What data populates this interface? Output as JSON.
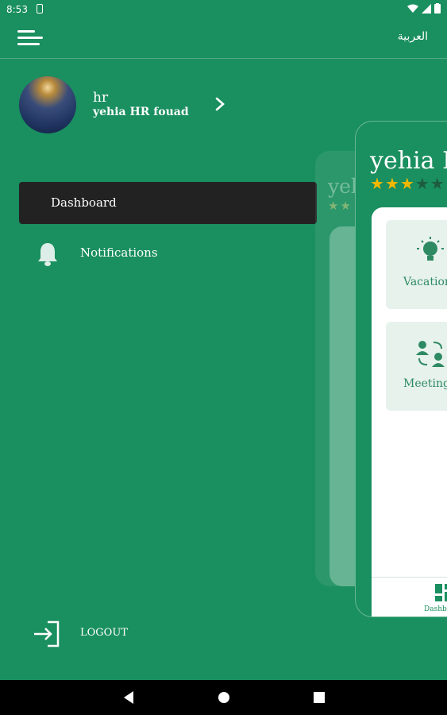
{
  "status_bar": {
    "time": "8:53"
  },
  "topbar": {
    "language_label": "العربية"
  },
  "profile": {
    "role": "hr",
    "name": "yehia HR fouad"
  },
  "nav": {
    "dashboard_label": "Dashboard",
    "notifications_label": "Notifications"
  },
  "logout_label": "LOGOUT",
  "preview": {
    "ghost_title": "yel",
    "title": "yehia E",
    "rating": {
      "value": 2.5,
      "max": 5
    },
    "tiles": [
      {
        "label": "Vacation",
        "icon": "lightbulb-icon"
      },
      {
        "label": "Meeting",
        "icon": "people-exchange-icon"
      }
    ],
    "bottom_tab_label": "Dashb"
  },
  "colors": {
    "primary": "#1a8f5f",
    "active_item": "#222222",
    "star": "#f5b800"
  }
}
